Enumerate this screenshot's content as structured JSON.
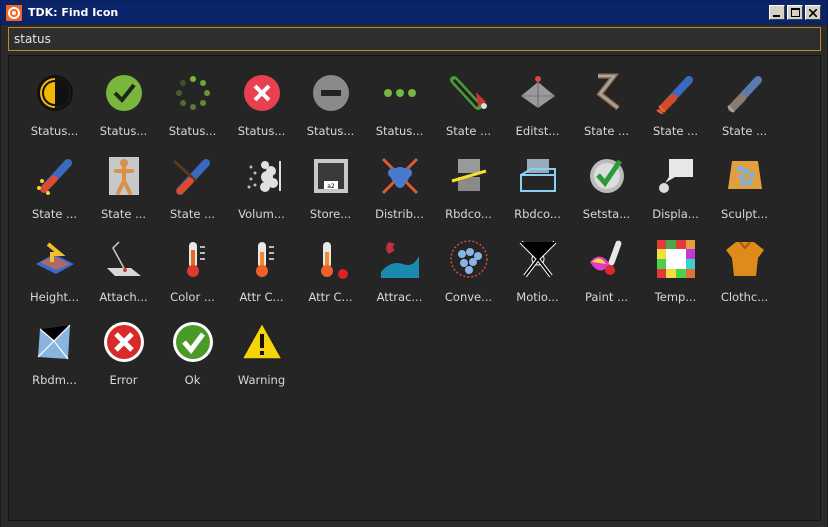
{
  "window": {
    "title": "TDK: Find Icon"
  },
  "search": {
    "value": "status"
  },
  "icons": [
    {
      "label": "Status...",
      "icon": "status-half-icon"
    },
    {
      "label": "Status...",
      "icon": "status-check-icon"
    },
    {
      "label": "Status...",
      "icon": "status-spinner-icon"
    },
    {
      "label": "Status...",
      "icon": "status-error-icon"
    },
    {
      "label": "Status...",
      "icon": "status-minus-icon"
    },
    {
      "label": "Status...",
      "icon": "status-dots-icon"
    },
    {
      "label": "State ...",
      "icon": "state-paint-icon"
    },
    {
      "label": "Editst...",
      "icon": "editstate-icon"
    },
    {
      "label": "State ...",
      "icon": "state-rig-icon"
    },
    {
      "label": "State ...",
      "icon": "state-arm-icon"
    },
    {
      "label": "State ...",
      "icon": "state-arm-gray-icon"
    },
    {
      "label": "State ...",
      "icon": "state-arm-sparks-icon"
    },
    {
      "label": "State ...",
      "icon": "state-figure-icon"
    },
    {
      "label": "State ...",
      "icon": "state-brush-icon"
    },
    {
      "label": "Volum...",
      "icon": "volume-icon"
    },
    {
      "label": "Store...",
      "icon": "store-icon"
    },
    {
      "label": "Distrib...",
      "icon": "distribute-icon"
    },
    {
      "label": "Rbdco...",
      "icon": "rbd-constraint-icon"
    },
    {
      "label": "Rbdco...",
      "icon": "rbd-constraint-wire-icon"
    },
    {
      "label": "Setsta...",
      "icon": "setstate-icon"
    },
    {
      "label": "Displa...",
      "icon": "display-icon"
    },
    {
      "label": "Sculpt...",
      "icon": "sculpt-icon"
    },
    {
      "label": "Height...",
      "icon": "heightfield-icon"
    },
    {
      "label": "Attach...",
      "icon": "attach-icon"
    },
    {
      "label": "Color ...",
      "icon": "color-thermometer-icon"
    },
    {
      "label": "Attr C...",
      "icon": "attr-thermometer-icon"
    },
    {
      "label": "Attr C...",
      "icon": "attr-thermometer-dot-icon"
    },
    {
      "label": "Attrac...",
      "icon": "attract-icon"
    },
    {
      "label": "Conve...",
      "icon": "convert-icon"
    },
    {
      "label": "Motio...",
      "icon": "motion-icon"
    },
    {
      "label": "Paint ...",
      "icon": "paint-thermometer-icon"
    },
    {
      "label": "Temp...",
      "icon": "temperature-grid-icon"
    },
    {
      "label": "Clothc...",
      "icon": "cloth-icon"
    },
    {
      "label": "Rbdm...",
      "icon": "rbd-material-icon"
    },
    {
      "label": "Error",
      "icon": "error-icon"
    },
    {
      "label": "Ok",
      "icon": "ok-icon"
    },
    {
      "label": "Warning",
      "icon": "warning-icon"
    }
  ]
}
